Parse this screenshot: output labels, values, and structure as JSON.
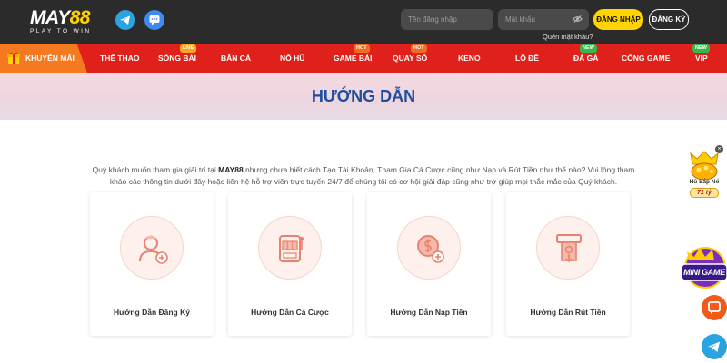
{
  "header": {
    "logo_text": "MAY88",
    "logo_tagline": "PLAY TO WIN",
    "username_placeholder": "Tên đăng nhập",
    "password_placeholder": "Mật khẩu",
    "forgot_label": "Quên mật khẩu?",
    "login_label": "ĐĂNG NHẬP",
    "register_label": "ĐĂNG KÝ"
  },
  "nav": {
    "promo_label": "KHUYẾN MÃI",
    "items": [
      {
        "label": "THỂ THAO",
        "badge": ""
      },
      {
        "label": "SÒNG BÀI",
        "badge": "LIVE"
      },
      {
        "label": "BẮN CÁ",
        "badge": ""
      },
      {
        "label": "NỔ HŨ",
        "badge": ""
      },
      {
        "label": "GAME BÀI",
        "badge": "HOT"
      },
      {
        "label": "QUAY SỐ",
        "badge": "HOT"
      },
      {
        "label": "KENO",
        "badge": ""
      },
      {
        "label": "LÔ ĐỀ",
        "badge": ""
      },
      {
        "label": "ĐÁ GÀ",
        "badge": "NEW"
      },
      {
        "label": "CỔNG GAME",
        "badge": ""
      },
      {
        "label": "VIP",
        "badge": "NEW"
      }
    ]
  },
  "hero": {
    "title": "HƯỚNG DẪN"
  },
  "intro": {
    "before_brand": "Quý khách muốn tham gia giải trí tại ",
    "brand": "MAY88",
    "after_brand": " nhưng chưa biết cách Tạo Tài Khoản, Tham Gia Cá Cược cũng như Nạp và Rút Tiền như thế nào? Vui lòng tham khảo các thông tin dưới đây hoặc liên hệ hỗ trợ viên trực tuyến 24/7 để chúng tôi có cơ hội giải đáp cũng như trợ giúp mọi thắc mắc của Quý khách."
  },
  "guides": [
    {
      "title": "Hướng Dẫn Đăng Ký",
      "icon": "user-add-icon"
    },
    {
      "title": "Hướng Dẫn Cá Cược",
      "icon": "slot-machine-icon"
    },
    {
      "title": "Hướng Dẫn Nạp Tiền",
      "icon": "coin-deposit-icon"
    },
    {
      "title": "Hướng Dẫn Rút Tiền",
      "icon": "atm-withdraw-icon"
    }
  ],
  "floats": {
    "jackpot_line1": "Hũ Sắp Nổ",
    "jackpot_value": "71 tỷ",
    "minigame_label": "MINI GAME"
  },
  "colors": {
    "topbar": "#2b2b2b",
    "nav_red": "#e0211b",
    "promo_orange": "#f47920",
    "accent_yellow": "#ffd400",
    "title_blue": "#1f4d9c",
    "icon_coral": "#e8826f"
  }
}
